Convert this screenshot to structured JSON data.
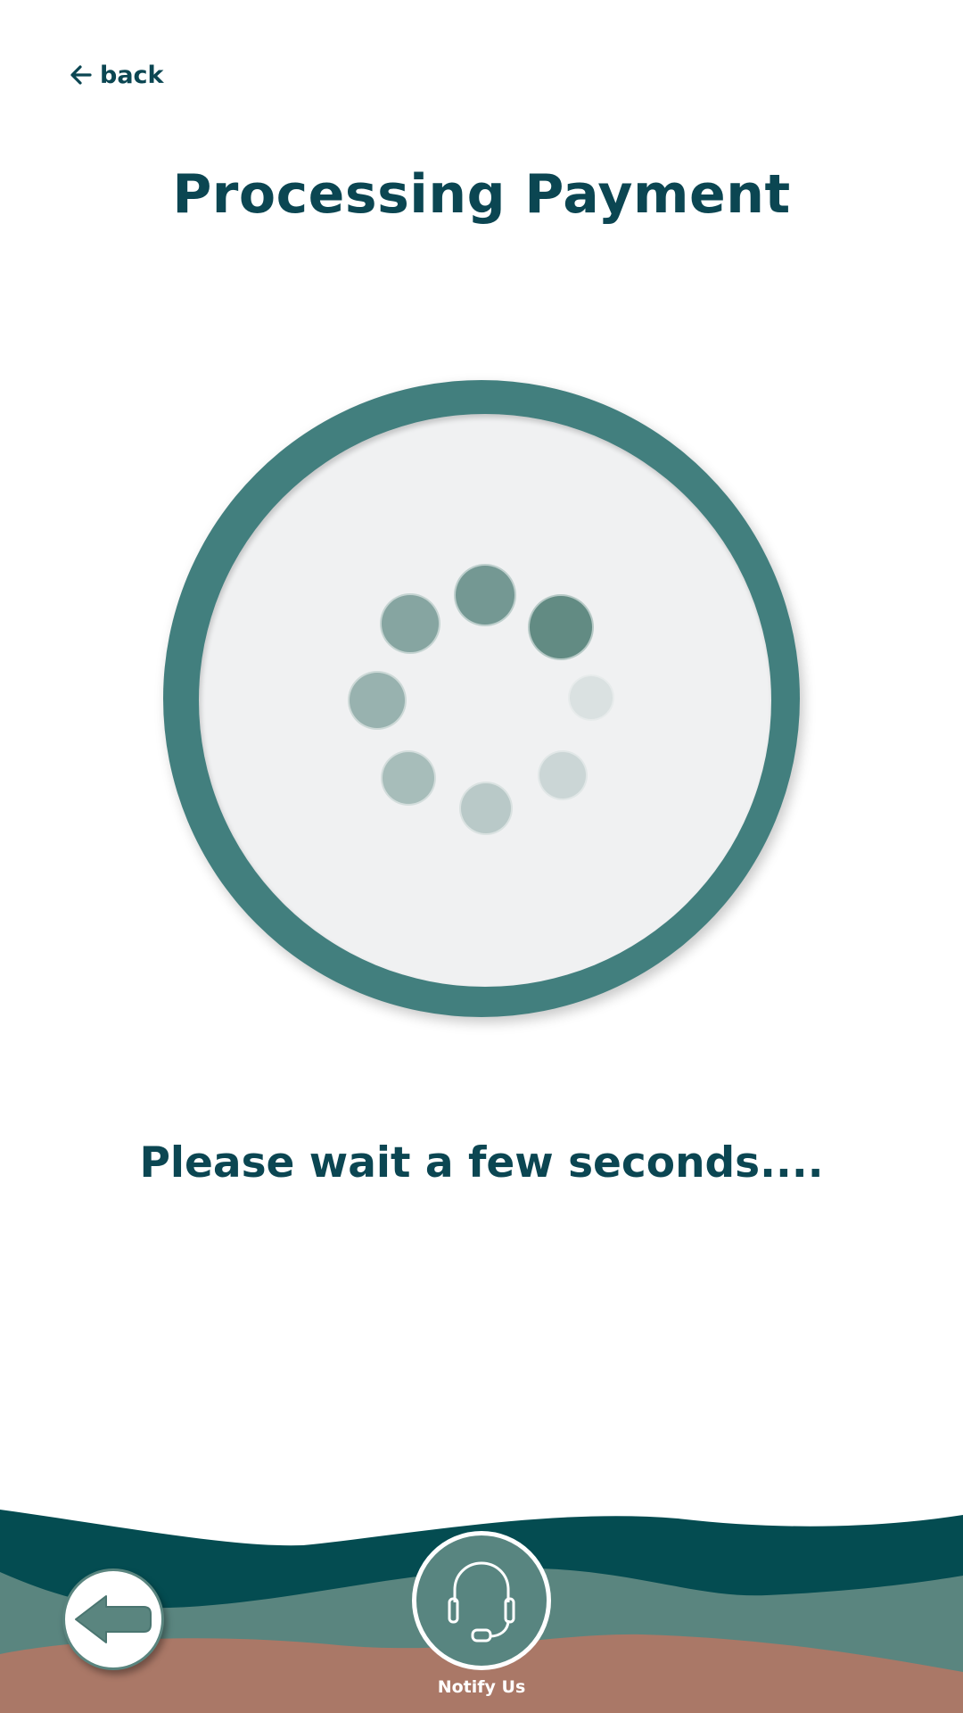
{
  "nav": {
    "back_label": "back",
    "back_icon": "arrow-left-icon"
  },
  "title": "Processing Payment",
  "spinner": {
    "icon": "loading-spinner",
    "ring_color": "#427f7e",
    "face_color": "#f0f1f2",
    "dot_color": "#5a857f"
  },
  "message": "Please wait a few seconds....",
  "footer": {
    "back_button_icon": "back-arrow-icon",
    "notify_icon": "headset-icon",
    "notify_label": "Notify Us",
    "wave_colors": [
      "#044c51",
      "#5a857f",
      "#aa7867"
    ]
  },
  "colors": {
    "primary_text": "#0b4652",
    "background": "#ffffff"
  }
}
